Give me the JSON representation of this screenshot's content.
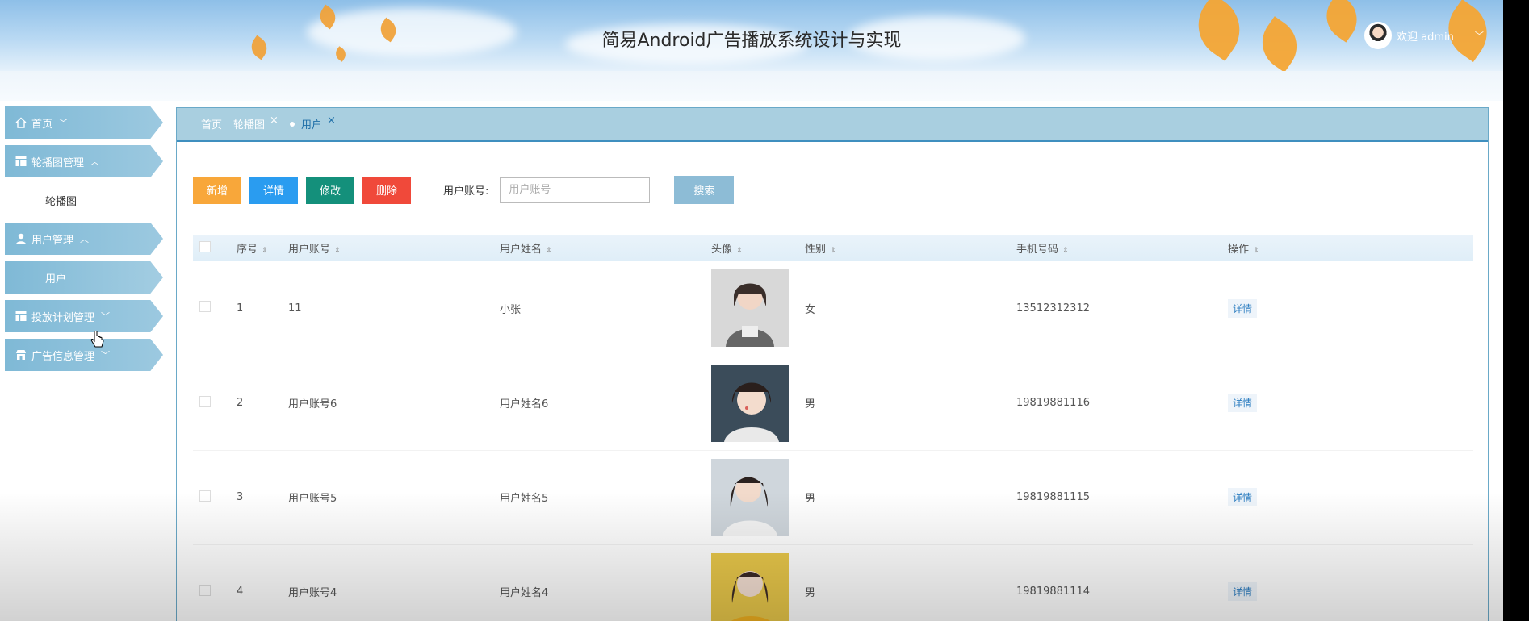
{
  "header": {
    "title": "简易Android广告播放系统设计与实现",
    "welcome": "欢迎 admin",
    "chevron": "chevron-down-icon"
  },
  "sidebar": {
    "items": [
      {
        "label": "首页",
        "icon": "home-icon",
        "chevron": "﹀"
      },
      {
        "label": "轮播图管理",
        "icon": "table-icon",
        "chevron": "︿"
      },
      {
        "label": "用户管理",
        "icon": "user-icon",
        "chevron": "︿"
      },
      {
        "label": "投放计划管理",
        "icon": "table-icon",
        "chevron": "﹀"
      },
      {
        "label": "广告信息管理",
        "icon": "store-icon",
        "chevron": "﹀"
      }
    ],
    "subs": {
      "carousel": "轮播图",
      "user": "用户"
    }
  },
  "tabs": [
    {
      "label": "首页"
    },
    {
      "label": "轮播图",
      "close": "×"
    },
    {
      "label": "用户",
      "close": "×"
    }
  ],
  "toolbar": {
    "add": "新增",
    "detail": "详情",
    "edit": "修改",
    "delete": "删除",
    "search_label": "用户账号:",
    "search_placeholder": "用户账号",
    "search_button": "搜索"
  },
  "table": {
    "headers": [
      "序号",
      "用户账号",
      "用户姓名",
      "头像",
      "性别",
      "手机号码",
      "操作"
    ],
    "rows": [
      {
        "no": "1",
        "account": "11",
        "name": "小张",
        "gender": "女",
        "phone": "13512312312",
        "action": "详情"
      },
      {
        "no": "2",
        "account": "用户账号6",
        "name": "用户姓名6",
        "gender": "男",
        "phone": "19819881116",
        "action": "详情"
      },
      {
        "no": "3",
        "account": "用户账号5",
        "name": "用户姓名5",
        "gender": "男",
        "phone": "19819881115",
        "action": "详情"
      },
      {
        "no": "4",
        "account": "用户账号4",
        "name": "用户姓名4",
        "gender": "男",
        "phone": "19819881114",
        "action": "详情"
      }
    ]
  },
  "colors": {
    "add": "#f8a73a",
    "detail": "#2a9cf0",
    "edit": "#14907b",
    "delete": "#f0493a",
    "search": "#8dbcd6",
    "sidebar": "#7fb9d6",
    "tabbar": "#a9cfe0"
  }
}
